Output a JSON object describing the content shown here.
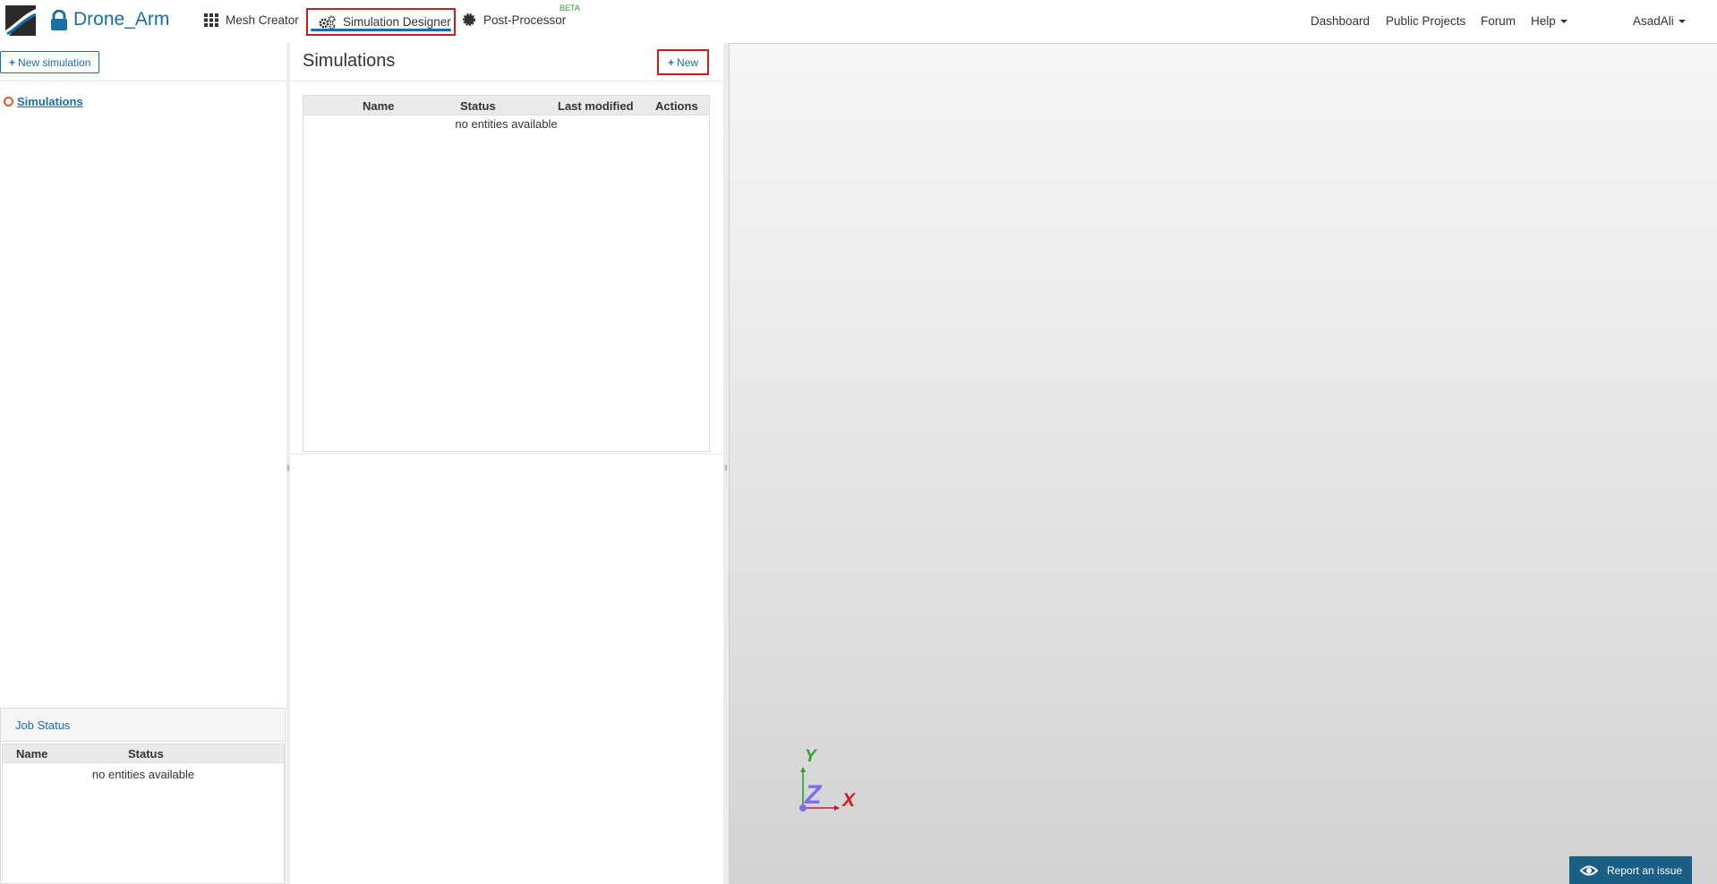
{
  "header": {
    "project_name": "Drone_Arm",
    "tabs": [
      {
        "label": "Mesh Creator",
        "icon": "grid-icon"
      },
      {
        "label": "Simulation Designer",
        "icon": "gears-icon",
        "active": true
      },
      {
        "label": "Post-Processor",
        "icon": "gear-icon",
        "badge": "BETA"
      }
    ],
    "right_nav": {
      "dashboard": "Dashboard",
      "public_projects": "Public Projects",
      "forum": "Forum",
      "help": "Help",
      "user": "AsadAli"
    }
  },
  "left_panel": {
    "new_simulation_label": "New simulation",
    "tree_root": "Simulations",
    "job_status": {
      "title": "Job Status",
      "columns": [
        "Name",
        "Status"
      ],
      "empty_text": "no entities available"
    }
  },
  "simulations": {
    "title": "Simulations",
    "new_label": "New",
    "columns": [
      "Name",
      "Status",
      "Last modified",
      "Actions"
    ],
    "empty_text": "no entities available"
  },
  "viewport": {
    "axes": {
      "x": "X",
      "y": "Y",
      "z": "Z"
    },
    "report_label": "Report an issue"
  },
  "colors": {
    "brand": "#1a6fa6",
    "highlight": "#d21a1a",
    "axis_x": "#d21a1a",
    "axis_y": "#2e9e2e",
    "axis_z": "#7b6ef0"
  }
}
